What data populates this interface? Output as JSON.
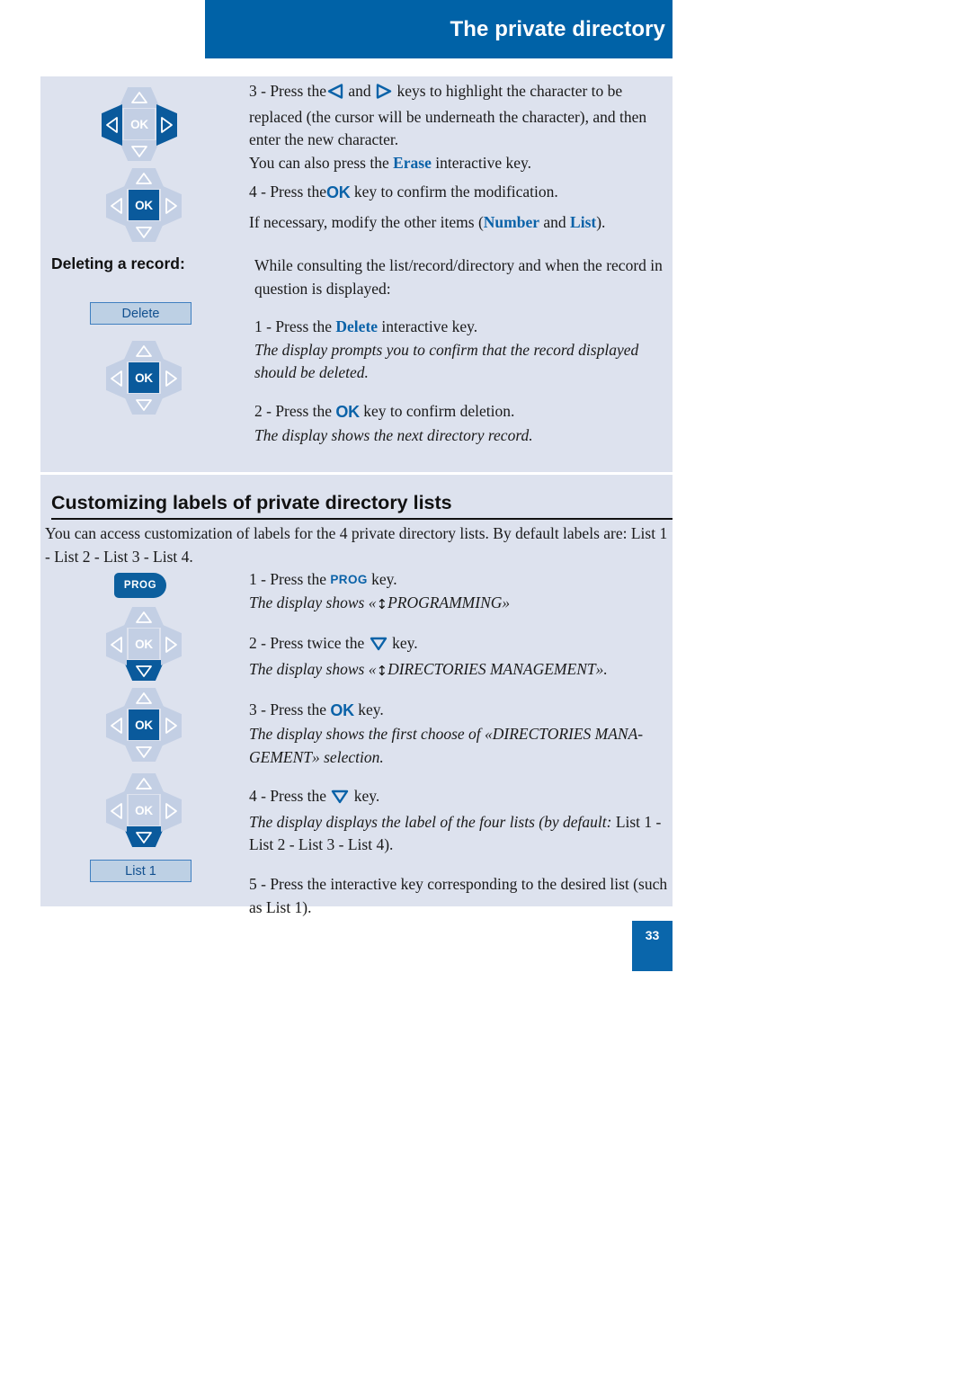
{
  "header": {
    "title": "The private directory",
    "bar_color": "#0062a7"
  },
  "page": {
    "number": "33",
    "panel_bg": "#dde2ee",
    "accent_blue": "#0a62a8"
  },
  "top_section": {
    "step3": {
      "prefix": "3 - Press the",
      "mid": "and",
      "suffix": "keys to highlight the character to be replaced (the cursor will be underneath the character), and then enter the new character.",
      "left_key_icon": "nav-left-arrow-icon",
      "right_key_icon": "nav-right-arrow-icon"
    },
    "erase_line": {
      "before": "You can also press the",
      "key": "Erase",
      "after": "interactive key."
    },
    "step4": {
      "before": "4 - Press the",
      "key": "OK",
      "after": "key to confirm the modification."
    },
    "note": {
      "before": "If necessary, modify the other items (",
      "key1": "Number",
      "mid": "and",
      "key2": "List",
      "after": ")."
    }
  },
  "delete_section": {
    "label": "Deleting a record:",
    "softkey_delete": "Delete",
    "intro": "While consulting the list/record/directory and when the record in question is displayed:",
    "step1": {
      "before": "1 - Press the",
      "key": "Delete",
      "after": "interactive key."
    },
    "step1_note": "The display prompts you to confirm that the record displayed should be deleted.",
    "step2": {
      "before": "2 - Press the",
      "key": "OK",
      "after": "key to confirm deletion."
    },
    "step2_note": "The display shows the next directory record."
  },
  "custom_section": {
    "heading": "Customizing labels of private directory lists",
    "intro": "You can access customization of labels for the 4 private directory lists. By default labels are: List 1 - List 2 - List 3 - List 4.",
    "prog_key_label": "PROG",
    "softkey_list1": "List 1",
    "step1": {
      "before": "1 - Press the",
      "key": "PROG",
      "after": "key."
    },
    "step1_note_before": "The display shows «",
    "step1_note_glyph": "↕",
    "step1_note_after": "PROGRAMMING»",
    "step2": {
      "before": "2 - Press twice the",
      "key_icon": "nav-down-arrow-icon",
      "after": "key."
    },
    "step2_note_before": "The display shows «",
    "step2_note_glyph": "↕",
    "step2_note_after": "DIRECTORIES MANAGEMENT».",
    "step3": {
      "before": "3 - Press the",
      "key": "OK",
      "after": "key."
    },
    "step3_note": "The display shows the first choose of «DIRECTORIES MANA-GEMENT» selection.",
    "step4": {
      "before": "4 - Press the",
      "key_icon": "nav-down-arrow-icon",
      "after": "key."
    },
    "step4_note_italic": "The display displays the label of the four lists (by default:",
    "step4_note_roman": " List 1 - List 2 - List 3 - List 4).",
    "step5": "5 - Press the interactive key corresponding to the desired list (such as List 1)."
  }
}
